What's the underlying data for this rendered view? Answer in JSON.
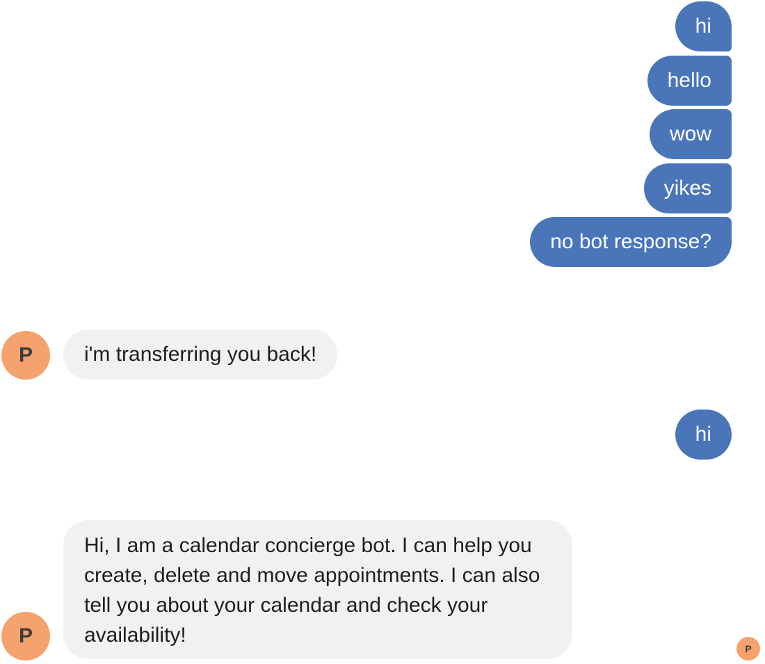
{
  "messages": {
    "outgoing_1": "hi",
    "outgoing_2": "hello",
    "outgoing_3": "wow",
    "outgoing_4": "yikes",
    "outgoing_5": "no bot response?",
    "incoming_1": "i'm transferring you back!",
    "outgoing_6": "hi",
    "incoming_2": "Hi, I am a calendar concierge bot. I can help you create, delete and move appointments. I can also tell you about your calendar and check your availability!"
  },
  "bot_avatar": {
    "letter": "P",
    "color": "#f5a26e"
  },
  "colors": {
    "outgoing_bubble": "#4a76b9",
    "incoming_bubble": "#f1f0f3"
  }
}
